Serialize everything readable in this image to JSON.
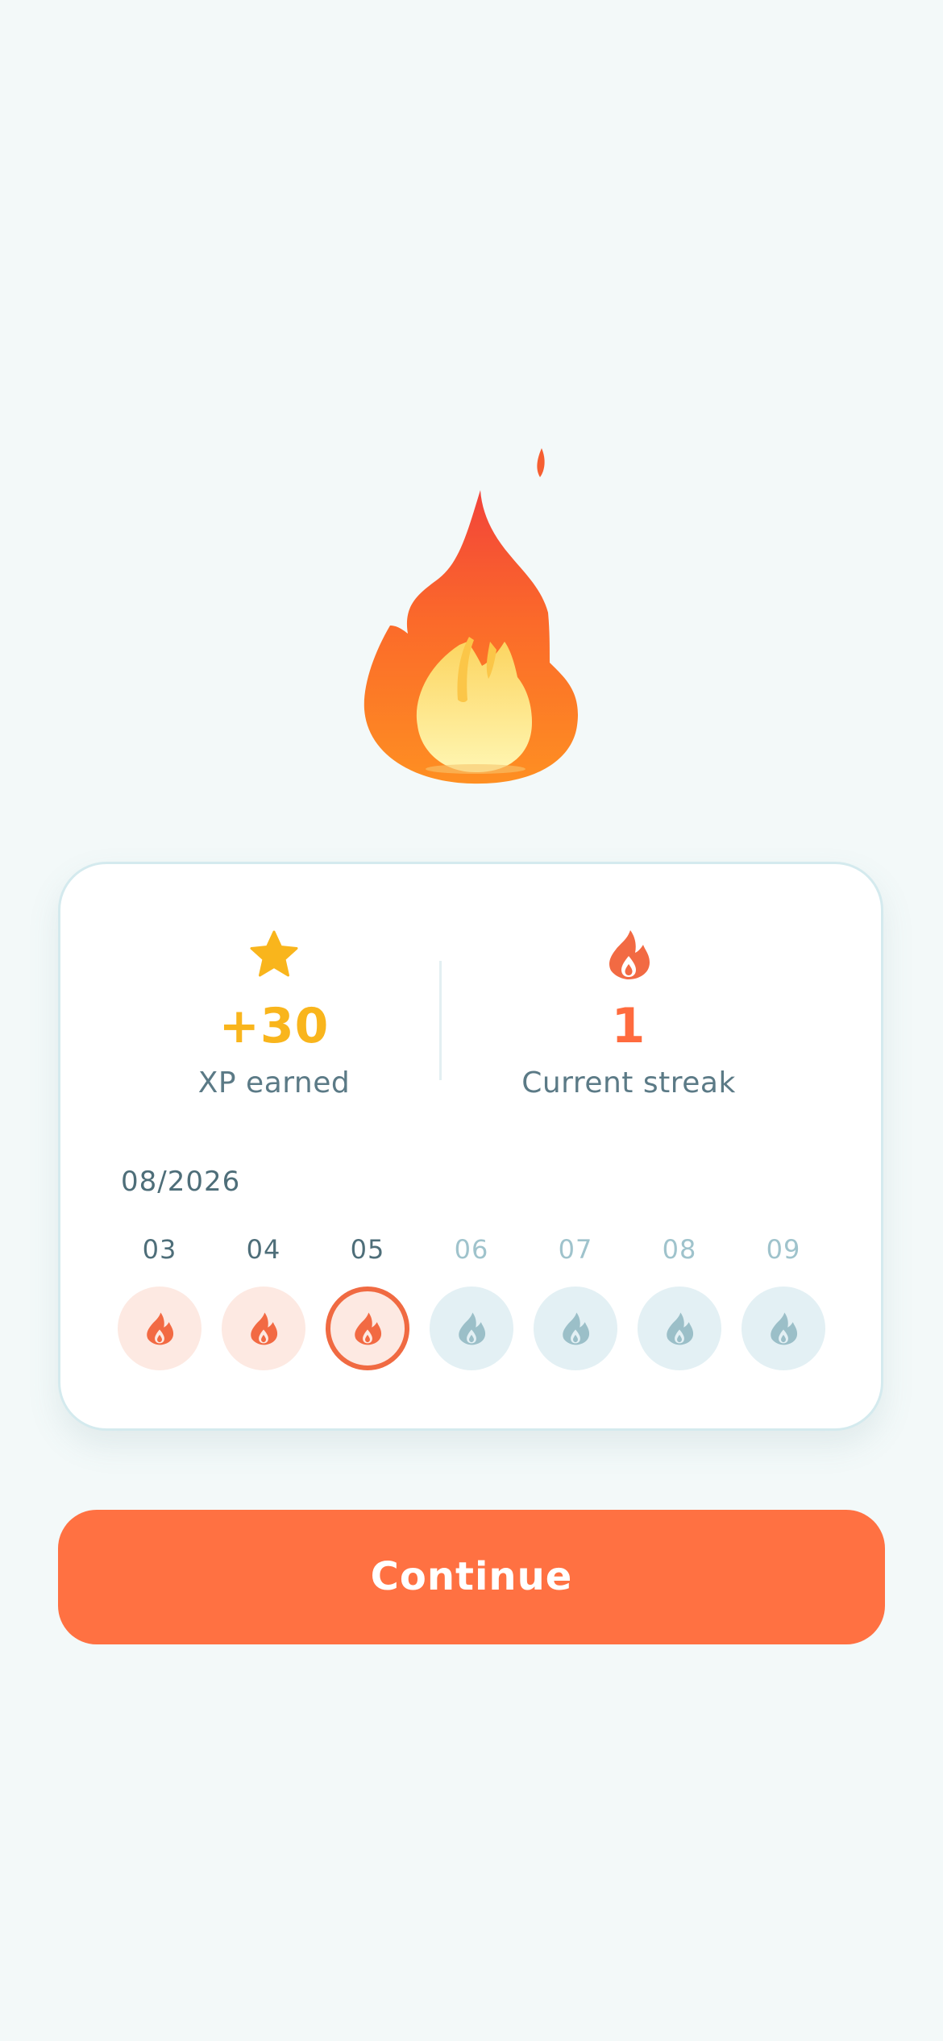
{
  "hero": {
    "icon": "fire-emoji"
  },
  "stats": {
    "xp": {
      "icon": "star-icon",
      "value": "+30",
      "label": "XP earned",
      "color": "#f9b51c"
    },
    "streak": {
      "icon": "flame-icon",
      "value": "1",
      "label": "Current streak",
      "color": "#ff6b3e"
    }
  },
  "calendar": {
    "month": "08/2026",
    "days": [
      {
        "label": "03",
        "state": "done"
      },
      {
        "label": "04",
        "state": "done"
      },
      {
        "label": "05",
        "state": "today"
      },
      {
        "label": "06",
        "state": "future"
      },
      {
        "label": "07",
        "state": "future"
      },
      {
        "label": "08",
        "state": "future"
      },
      {
        "label": "09",
        "state": "future"
      }
    ]
  },
  "actions": {
    "continue_label": "Continue",
    "accent_color": "#ff7142"
  }
}
